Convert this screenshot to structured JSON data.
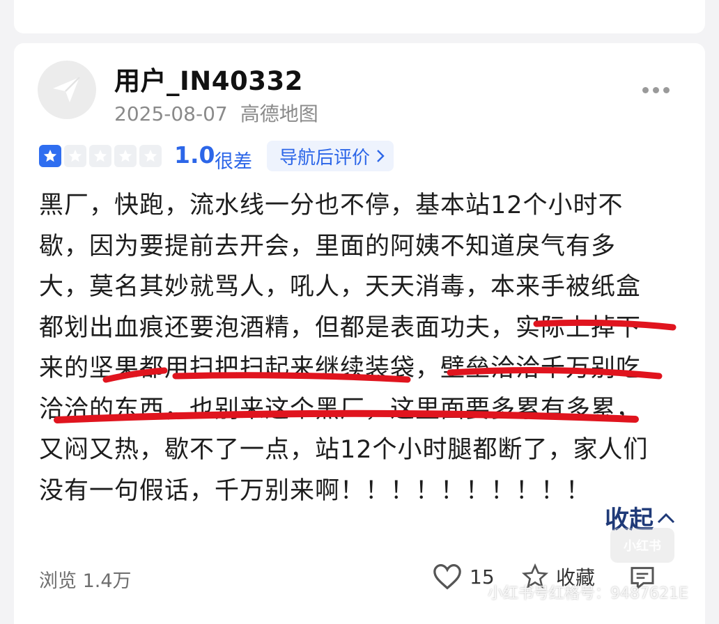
{
  "user": {
    "name": "用户_IN40332",
    "date": "2025-08-07",
    "source": "高德地图"
  },
  "rating": {
    "score": "1.0",
    "label": "很差",
    "filled_stars": 1,
    "total_stars": 5,
    "tag": "导航后评价"
  },
  "review": {
    "lines": [
      "黑厂，快跑，流水线一分也不停，基本站12个小时不",
      "歇，因为要提前去开会，里面的阿姨不知道戾气有多",
      "大，莫名其妙就骂人，吼人，天天消毒，本来手被纸盒",
      "都划出血痕还要泡酒精，但都是表面功夫，实际上掉下",
      "来的坚果都用扫把扫起来继续装袋，壁垒洽洽千万别吃",
      "洽洽的东西，也别来这个黑厂，这里面要多累有多累，",
      "又闷又热，歇不了一点，站12个小时腿都断了，家人们",
      "没有一句假话，千万别来啊！！！！！！！！！！"
    ]
  },
  "collapse_label": "收起",
  "footer": {
    "views": "浏览 1.4万",
    "likes": "15",
    "favorite_label": "收藏"
  },
  "watermark": {
    "text": "小红书号红格号：9487621E",
    "logo": "小红书"
  },
  "colors": {
    "accent": "#2c66e8",
    "underline": "#e0141e",
    "collapse": "#1f3a78"
  }
}
